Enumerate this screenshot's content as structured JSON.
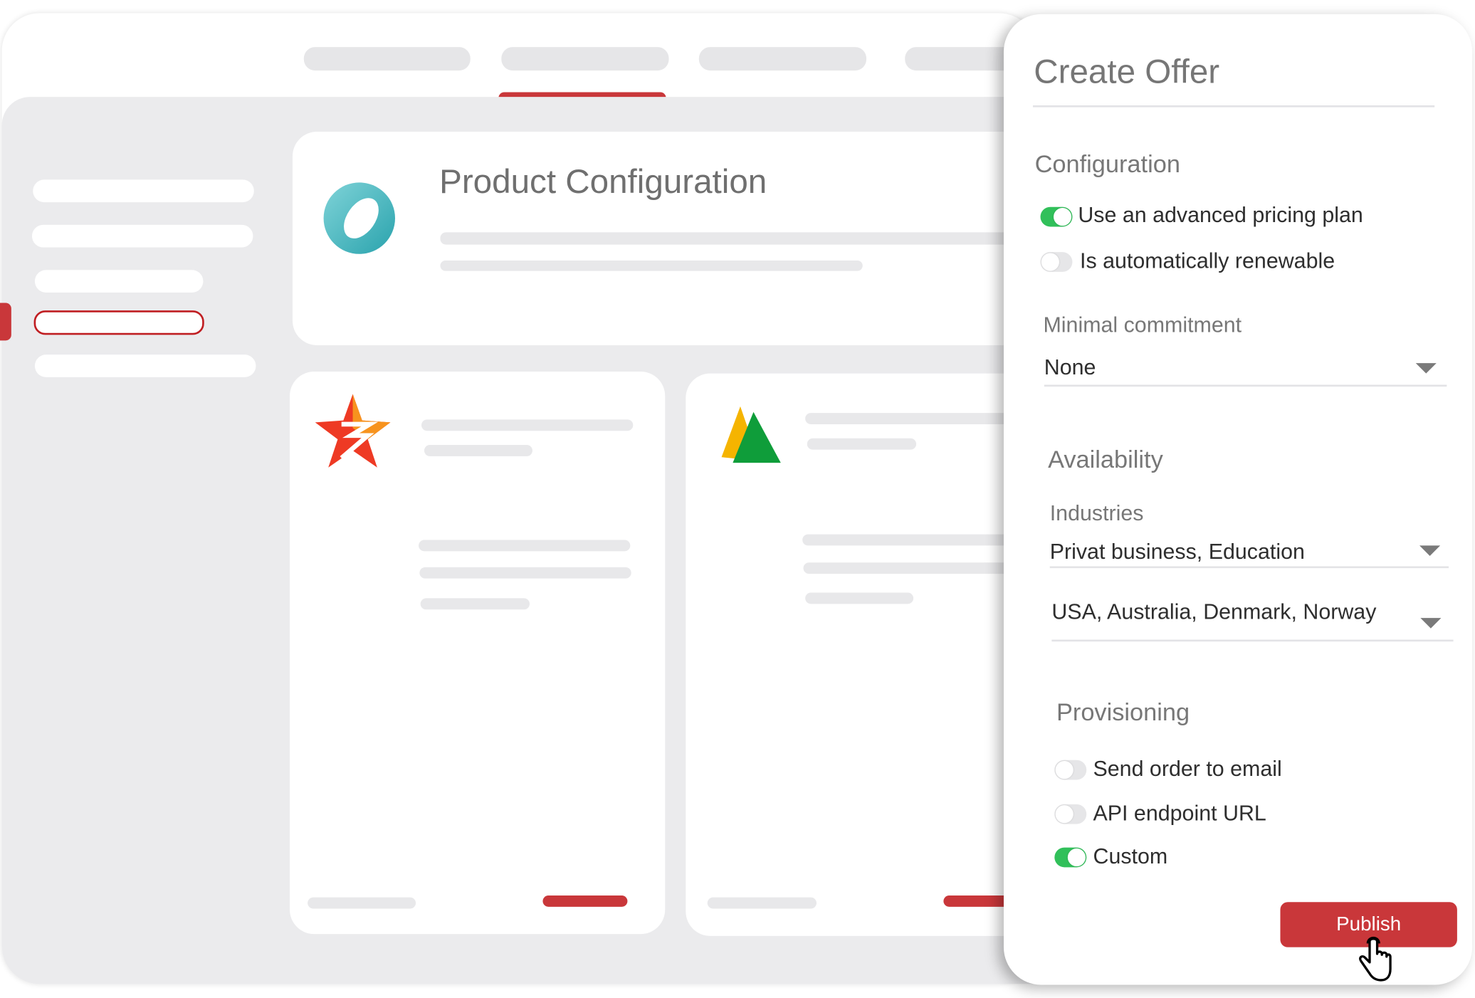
{
  "background_page": {
    "title": "Product Configuration",
    "active_tab_index": 1,
    "accent_color": "#c9373a"
  },
  "panel": {
    "title": "Create Offer",
    "configuration": {
      "heading": "Configuration",
      "toggles": [
        {
          "label": "Use an advanced pricing plan",
          "on": true
        },
        {
          "label": "Is automatically renewable",
          "on": false
        }
      ],
      "minimal_commitment": {
        "label": "Minimal commitment",
        "value": "None"
      }
    },
    "availability": {
      "heading": "Availability",
      "industries": {
        "label": "Industries",
        "value": "Privat business, Education"
      },
      "countries": {
        "value": "USA, Australia, Denmark, Norway"
      }
    },
    "provisioning": {
      "heading": "Provisioning",
      "toggles": [
        {
          "label": "Send order to email",
          "on": false
        },
        {
          "label": "API endpoint URL",
          "on": false
        },
        {
          "label": "Custom",
          "on": true
        }
      ]
    },
    "publish_label": "Publish",
    "toggle_on_color": "#31c05a"
  }
}
